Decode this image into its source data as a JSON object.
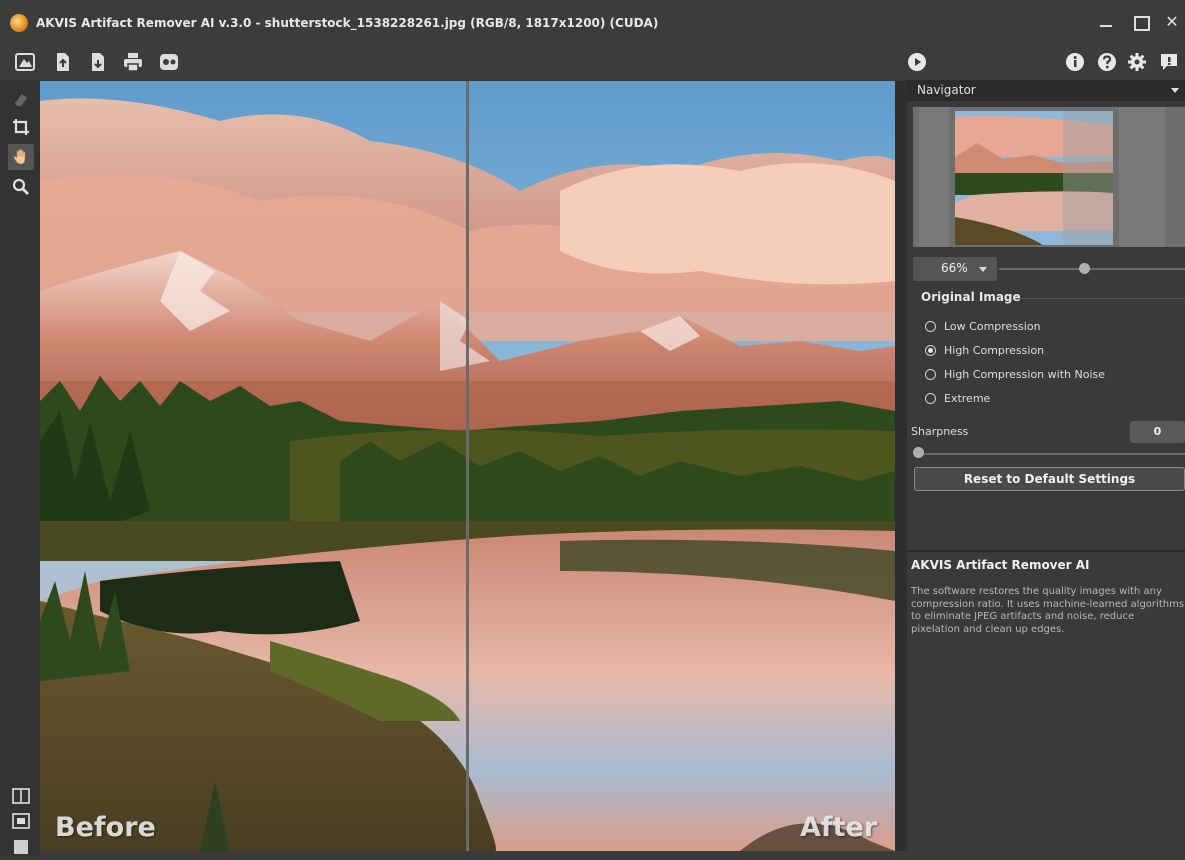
{
  "window": {
    "title": "AKVIS Artifact Remover AI v.3.0 - shutterstock_1538228261.jpg (RGB/8, 1817x1200) (CUDA)",
    "close_glyph": "✕"
  },
  "toolbar": {
    "left_icons": [
      "home-icon",
      "open-file-icon",
      "save-file-icon",
      "print-icon",
      "share-icon"
    ],
    "run_icon": "play-icon",
    "right_icons": [
      "info-icon",
      "help-icon",
      "settings-icon",
      "notifications-icon"
    ]
  },
  "tools": [
    "eraser-icon",
    "crop-icon",
    "hand-icon",
    "zoom-icon"
  ],
  "view_modes": [
    "split-view-icon",
    "before-after-view-icon",
    "single-view-icon"
  ],
  "canvas": {
    "before_label": "Before",
    "after_label": "After"
  },
  "navigator": {
    "title": "Navigator",
    "zoom": "66%",
    "zoom_level": 0.47
  },
  "settings": {
    "group_title": "Original Image",
    "options": [
      "Low Compression",
      "High Compression",
      "High Compression with Noise",
      "Extreme"
    ],
    "selected": "High Compression",
    "sharpness_label": "Sharpness",
    "sharpness_value": "0",
    "reset_label": "Reset to Default Settings"
  },
  "info": {
    "title": "AKVIS Artifact Remover AI",
    "text": "The software restores the quality images with any compression ratio. It uses machine-learned algorithms to eliminate JPEG artifacts and noise, reduce pixelation and clean up edges."
  },
  "colors": {
    "panel": "#3a3a3a",
    "toolbar": "#3c3c3c",
    "sky": "#7fb2d9",
    "cloud": "#e4a08c",
    "mountain": "#c77a63",
    "forest": "#2f4a1e"
  }
}
